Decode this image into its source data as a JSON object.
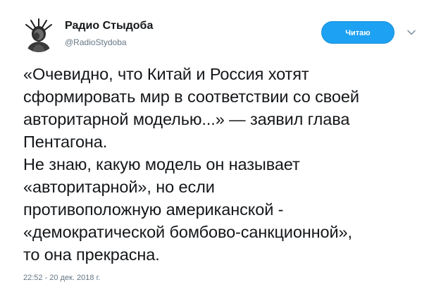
{
  "author": {
    "display_name": "Радио Стыдоба",
    "handle": "@RadioStydoba",
    "avatar_icon": "statue-of-liberty-avatar-icon"
  },
  "follow_button": {
    "label": "Читаю",
    "color": "#1da1f2"
  },
  "menu": {
    "icon": "chevron-down-icon"
  },
  "tweet": {
    "lines": [
      "«Очевидно, что Китай и Россия хотят",
      "сформировать мир в соответствии со своей",
      "авторитарной моделью...» — заявил глава",
      "Пентагона.",
      "Не знаю, какую модель он называет",
      "«авторитарной», но если",
      "противоположную американской -",
      "«демократической бомбово-санкционной»,",
      "то она прекрасна."
    ],
    "timestamp": "22:52 - 20 дек. 2018 г."
  }
}
